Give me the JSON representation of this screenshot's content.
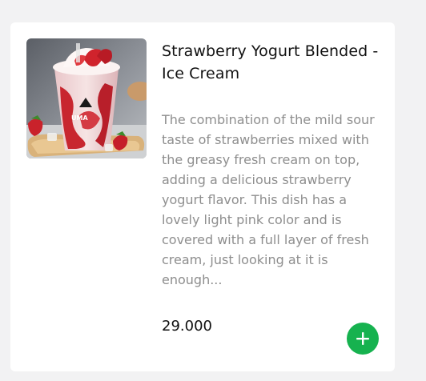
{
  "product": {
    "title": "Strawberry Yogurt Blended - Ice Cream",
    "description": "The combination of the mild sour taste of strawberries mixed with the greasy fresh cream on top, adding a delicious strawberry yogurt flavor. This dish has a lovely light pink color and is covered with a full layer of fresh cream, just looking at it is enough...",
    "price": "29.000",
    "image": {
      "icon": "strawberry-yogurt-cup-photo",
      "brand_text": "UMA"
    }
  },
  "actions": {
    "add_icon": "plus-icon"
  },
  "colors": {
    "page_background": "#f2f2f3",
    "card_background": "#ffffff",
    "title_text": "#111111",
    "description_text": "#8e8e8e",
    "add_button": "#16b24f"
  }
}
